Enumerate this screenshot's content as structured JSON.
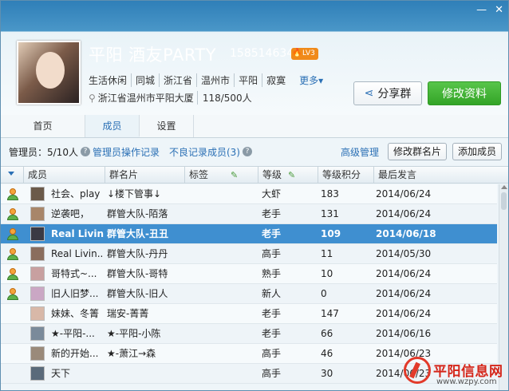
{
  "group": {
    "name": "平阳 酒友PARTY",
    "id": "158514634",
    "level": "LV3",
    "tags": [
      "生活休闲",
      "同城",
      "浙江省",
      "温州市",
      "平阳",
      "寂寞"
    ],
    "more_label": "更多",
    "location": "浙江省温州市平阳大厦",
    "members": "118/500人"
  },
  "buttons": {
    "share": "分享群",
    "edit": "修改资料"
  },
  "tabs": [
    "首页",
    "成员",
    "设置"
  ],
  "active_tab": 1,
  "toolbar": {
    "admin_count": "管理员：5/10人",
    "admin_log": "管理员操作记录",
    "bad_log": "不良记录成员(3)",
    "senior_admin": "高级管理",
    "edit_card": "修改群名片",
    "add_member": "添加成员"
  },
  "columns": [
    "成员",
    "群名片",
    "标签",
    "等级",
    "等级积分",
    "最后发言"
  ],
  "rows": [
    {
      "admin": true,
      "member": "社会、play",
      "card": "↓楼下管事↓",
      "level": "大虾",
      "points": "183",
      "last": "2014/06/24"
    },
    {
      "admin": true,
      "member": "逆袭吧，",
      "card": "群管大队-陌落",
      "level": "老手",
      "points": "131",
      "last": "2014/06/24"
    },
    {
      "admin": true,
      "member": "Real Livin...",
      "card": "群管大队-丑丑",
      "level": "老手",
      "points": "109",
      "last": "2014/06/18",
      "selected": true
    },
    {
      "admin": true,
      "member": "Real Livin...",
      "card": "群管大队-丹丹",
      "level": "高手",
      "points": "11",
      "last": "2014/05/30"
    },
    {
      "admin": true,
      "member": "哥特式~...",
      "card": "群管大队-哥特",
      "level": "熟手",
      "points": "10",
      "last": "2014/06/24"
    },
    {
      "admin": true,
      "member": "旧人旧梦...",
      "card": "群管大队-旧人",
      "level": "新人",
      "points": "0",
      "last": "2014/06/24"
    },
    {
      "admin": false,
      "member": "妹妹、冬箐",
      "card": "瑞安-菁菁",
      "level": "老手",
      "points": "147",
      "last": "2014/06/24"
    },
    {
      "admin": false,
      "member": "★-平阳-...",
      "card": "★-平阳-小陈",
      "level": "老手",
      "points": "66",
      "last": "2014/06/16"
    },
    {
      "admin": false,
      "member": "新的开始...",
      "card": "★-萧江→森",
      "level": "高手",
      "points": "46",
      "last": "2014/06/23"
    },
    {
      "admin": false,
      "member": "天下",
      "card": "",
      "level": "高手",
      "points": "30",
      "last": "2014/06/23"
    }
  ],
  "watermark": {
    "title": "平阳信息网",
    "url": "www.wzpy.com"
  },
  "colors": {
    "accent": "#2b70b5",
    "selected_row": "#3f8fd0",
    "edit_button": "#33a427"
  }
}
